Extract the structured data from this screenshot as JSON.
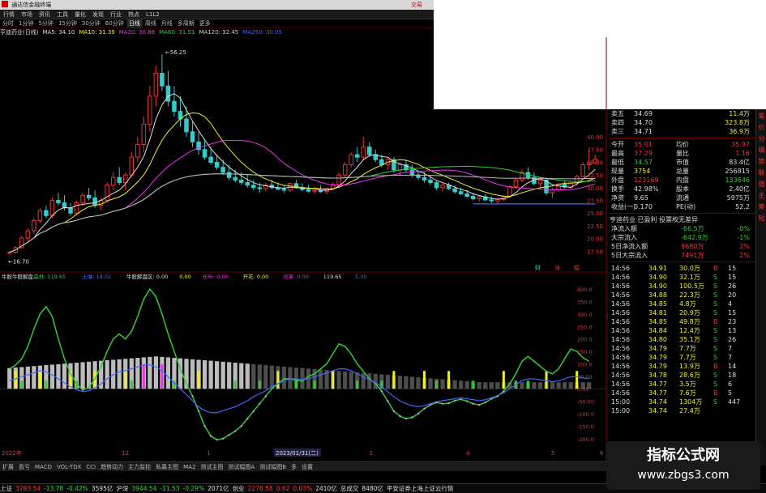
{
  "window": {
    "title": "通达信金融终端",
    "right_label": "交易"
  },
  "menu": [
    "行情",
    "市场",
    "资讯",
    "工具",
    "量化",
    "发现",
    "行业",
    "热点",
    "L1L2"
  ],
  "periods": [
    "分时",
    "1分钟",
    "5分钟",
    "15分钟",
    "30分钟",
    "60分钟",
    "日线",
    "周线",
    "月线",
    "多周期",
    "更多"
  ],
  "active_period": "日线",
  "ma_legend": [
    {
      "label": "亨迪药业(日线)",
      "color": "#dddddd"
    },
    {
      "label": "MA5: 34.10",
      "color": "#dddddd"
    },
    {
      "label": "MA10: 31.39",
      "color": "#eeee33"
    },
    {
      "label": "MA20: 30.88",
      "color": "#ee33ee"
    },
    {
      "label": "MA60: 31.51",
      "color": "#33cc33"
    },
    {
      "label": "MA120: 32.45",
      "color": "#cccccc"
    },
    {
      "label": "MA250: 30.05",
      "color": "#4466ff"
    }
  ],
  "chart": {
    "price_high_label": "56.25",
    "price_low_label": "16.70",
    "price_axis": [
      "40.00",
      "37.50",
      "35.00",
      "32.50",
      "30.00",
      "27.50",
      "25.00",
      "22.50",
      "20.00",
      "17.50"
    ],
    "markers": [
      "财",
      "涨",
      "幅"
    ],
    "indicator_name": "牛股牛股解盘",
    "indicator_legend": [
      {
        "label": "牛股牛股解盘",
        "color": "#dddddd"
      },
      {
        "label": "森林: 119.65",
        "color": "#33cc33"
      },
      {
        "label": "土壤: 19.02",
        "color": "#4466ff"
      },
      {
        "label": "牛股解盘区: 0.00",
        "color": "#dddddd"
      },
      {
        "label": "0.00",
        "color": "#eeee33"
      },
      {
        "label": "长叶: 0.00",
        "color": "#ee33ee"
      },
      {
        "label": "开花: 0.00",
        "color": "#eeee33"
      },
      {
        "label": "结果: 0.00",
        "color": "#cc33cc"
      },
      {
        "label": "119.65",
        "color": "#dddddd"
      },
      {
        "label": "5.00",
        "color": "#4466ff"
      }
    ],
    "indicator_axis": [
      "400.0",
      "350.0",
      "300.0",
      "250.0",
      "200.0",
      "150.0",
      "100.0",
      "50.00",
      "0.00",
      "-50.00",
      "-100.0",
      "-150.0",
      "-200.0"
    ],
    "crosshair_value": "287.38",
    "date_axis": [
      "2022年",
      "12",
      "1",
      "2023/01/31(二)",
      "3",
      "4",
      "5",
      "6"
    ],
    "candles": [
      [
        17.2,
        17.5,
        16.7,
        17.3
      ],
      [
        17.3,
        18.5,
        17.1,
        18.2
      ],
      [
        18.2,
        20.5,
        18,
        20.1
      ],
      [
        20.1,
        22,
        19.5,
        21.5
      ],
      [
        21.5,
        24,
        21,
        23.5
      ],
      [
        23.5,
        26,
        23,
        25.5
      ],
      [
        25.5,
        26.5,
        24,
        24.5
      ],
      [
        24.5,
        28,
        24,
        27.5
      ],
      [
        27.5,
        29,
        26.5,
        27
      ],
      [
        27,
        28.5,
        25.5,
        26
      ],
      [
        26,
        27,
        24.5,
        25
      ],
      [
        25,
        27.5,
        24.5,
        27
      ],
      [
        27,
        29,
        26.5,
        28.5
      ],
      [
        28.5,
        30,
        27.5,
        28
      ],
      [
        28,
        29.5,
        26,
        26.5
      ],
      [
        26.5,
        28,
        25.5,
        27.5
      ],
      [
        27.5,
        31,
        27,
        30.5
      ],
      [
        30.5,
        33,
        29.5,
        32
      ],
      [
        32,
        34,
        30.5,
        31
      ],
      [
        31,
        33,
        29.5,
        32.5
      ],
      [
        32.5,
        37,
        32,
        36
      ],
      [
        36,
        40,
        35,
        38.5
      ],
      [
        38.5,
        44,
        37,
        42.5
      ],
      [
        42.5,
        50,
        41,
        48
      ],
      [
        48,
        54,
        46,
        52.5
      ],
      [
        52.5,
        56.25,
        49,
        50
      ],
      [
        50,
        53,
        46,
        47
      ],
      [
        47,
        50,
        44,
        45
      ],
      [
        45,
        48,
        42,
        43.5
      ],
      [
        43.5,
        46,
        40,
        41
      ],
      [
        41,
        43,
        38,
        39
      ],
      [
        39,
        41,
        36.5,
        37.5
      ],
      [
        37.5,
        39.5,
        35.5,
        36
      ],
      [
        36,
        38,
        34.5,
        35
      ],
      [
        35,
        36.5,
        33.5,
        34
      ],
      [
        34,
        35.5,
        32.5,
        33
      ],
      [
        33,
        34.5,
        31.5,
        32
      ],
      [
        32,
        33.5,
        31,
        31.5
      ],
      [
        31.5,
        33,
        30.5,
        31
      ],
      [
        31,
        32.5,
        30,
        30.5
      ],
      [
        30.5,
        31.5,
        29.5,
        30
      ],
      [
        30,
        31,
        29,
        29.8
      ],
      [
        29.8,
        31,
        29.3,
        30.5
      ],
      [
        30.5,
        31.5,
        29.7,
        30
      ],
      [
        30,
        31,
        29.5,
        29.7
      ],
      [
        29.7,
        30.5,
        29,
        29.5
      ],
      [
        29.5,
        31,
        29.2,
        30.8
      ],
      [
        30.8,
        31.5,
        29.8,
        30
      ],
      [
        30,
        30.8,
        29.3,
        29.6
      ],
      [
        29.6,
        30.5,
        29,
        29.3
      ],
      [
        29.3,
        30.2,
        28.8,
        29.5
      ],
      [
        29.5,
        30.5,
        29,
        29.2
      ],
      [
        29.2,
        30,
        28.7,
        29.8
      ],
      [
        29.8,
        31,
        29.4,
        30.6
      ],
      [
        30.6,
        33,
        30,
        32.5
      ],
      [
        32.5,
        35,
        32,
        34.5
      ],
      [
        34.5,
        37,
        34,
        36.5
      ],
      [
        36.5,
        38,
        35,
        36
      ],
      [
        36,
        40,
        35.5,
        38
      ],
      [
        38,
        39,
        36,
        36.5
      ],
      [
        36.5,
        37.5,
        35,
        35.5
      ],
      [
        35.5,
        36.5,
        34,
        34.5
      ],
      [
        34.5,
        36,
        33.5,
        35.5
      ],
      [
        35.5,
        36,
        33,
        33.5
      ],
      [
        33.5,
        35,
        32.5,
        34.5
      ],
      [
        34.5,
        35.5,
        33,
        33.5
      ],
      [
        33.5,
        34.5,
        32,
        32.5
      ],
      [
        32.5,
        33.5,
        31.5,
        32
      ],
      [
        32,
        33,
        31,
        31.5
      ],
      [
        31.5,
        32.5,
        30.5,
        31
      ],
      [
        31,
        31.5,
        29.5,
        30
      ],
      [
        30,
        31,
        29.3,
        30.5
      ],
      [
        30.5,
        31,
        29.5,
        29.8
      ],
      [
        29.8,
        30.5,
        28.8,
        29.2
      ],
      [
        29.2,
        30,
        28.5,
        28.8
      ],
      [
        28.8,
        29.5,
        28,
        28.3
      ],
      [
        28.3,
        29,
        27.5,
        27.8
      ],
      [
        27.8,
        28.5,
        27.2,
        28.2
      ],
      [
        28.2,
        28.8,
        27.3,
        27.6
      ],
      [
        27.6,
        28.3,
        27,
        27.4
      ],
      [
        27.4,
        28,
        26.8,
        27.7
      ],
      [
        27.7,
        28.5,
        27.3,
        28.2
      ],
      [
        28.2,
        30.5,
        28,
        30.2
      ],
      [
        30.2,
        32,
        29.8,
        31.5
      ],
      [
        31.5,
        33.5,
        31,
        33
      ],
      [
        33,
        34,
        31.5,
        32
      ],
      [
        32,
        33,
        30.5,
        30.8
      ],
      [
        30.8,
        32,
        30,
        31.5
      ],
      [
        31.5,
        32,
        28.5,
        29
      ],
      [
        29,
        30,
        28,
        29.6
      ],
      [
        29.6,
        31,
        29.2,
        30.7
      ],
      [
        30.7,
        31.5,
        29.8,
        30.1
      ],
      [
        30.1,
        31.2,
        29.7,
        30.9
      ],
      [
        30.9,
        32.5,
        30.5,
        32.2
      ],
      [
        32.2,
        35,
        32,
        34.5
      ],
      [
        34.5,
        37.3,
        33.5,
        34.9
      ],
      [
        34.9,
        36.5,
        34.57,
        35.6
      ]
    ],
    "indicator": [
      [
        80,
        8
      ],
      [
        95,
        10
      ],
      [
        120,
        12
      ],
      [
        170,
        14
      ],
      [
        240,
        16
      ],
      [
        300,
        18
      ],
      [
        330,
        17
      ],
      [
        290,
        14
      ],
      [
        200,
        10
      ],
      [
        120,
        6
      ],
      [
        60,
        2
      ],
      [
        20,
        -1
      ],
      [
        -5,
        -3
      ],
      [
        5,
        -2
      ],
      [
        40,
        1
      ],
      [
        90,
        5
      ],
      [
        150,
        10
      ],
      [
        200,
        14
      ],
      [
        220,
        17
      ],
      [
        200,
        18
      ],
      [
        230,
        20
      ],
      [
        290,
        22
      ],
      [
        360,
        24
      ],
      [
        400,
        24
      ],
      [
        370,
        22
      ],
      [
        300,
        18
      ],
      [
        220,
        12
      ],
      [
        150,
        6
      ],
      [
        80,
        0
      ],
      [
        20,
        -6
      ],
      [
        -30,
        -12
      ],
      [
        -90,
        -18
      ],
      [
        -150,
        -22
      ],
      [
        -190,
        -24
      ],
      [
        -205,
        -24
      ],
      [
        -200,
        -22
      ],
      [
        -185,
        -20
      ],
      [
        -170,
        -18
      ],
      [
        -150,
        -15
      ],
      [
        -120,
        -12
      ],
      [
        -90,
        -8
      ],
      [
        -60,
        -5
      ],
      [
        -30,
        -2
      ],
      [
        0,
        2
      ],
      [
        20,
        5
      ],
      [
        40,
        8
      ],
      [
        40,
        10
      ],
      [
        35,
        10
      ],
      [
        30,
        9
      ],
      [
        50,
        10
      ],
      [
        60,
        12
      ],
      [
        80,
        14
      ],
      [
        100,
        16
      ],
      [
        140,
        18
      ],
      [
        180,
        20
      ],
      [
        170,
        20
      ],
      [
        140,
        18
      ],
      [
        100,
        15
      ],
      [
        70,
        12
      ],
      [
        40,
        9
      ],
      [
        20,
        6
      ],
      [
        -10,
        2
      ],
      [
        -50,
        -3
      ],
      [
        -90,
        -8
      ],
      [
        -110,
        -12
      ],
      [
        -120,
        -15
      ],
      [
        -115,
        -17
      ],
      [
        -100,
        -18
      ],
      [
        -80,
        -17
      ],
      [
        -65,
        -15
      ],
      [
        -55,
        -13
      ],
      [
        -60,
        -12
      ],
      [
        -58,
        -11
      ],
      [
        -48,
        -10
      ],
      [
        -42,
        -9
      ],
      [
        -50,
        -10
      ],
      [
        -60,
        -11
      ],
      [
        -65,
        -12
      ],
      [
        -55,
        -11
      ],
      [
        -40,
        -9
      ],
      [
        -30,
        -7
      ],
      [
        -10,
        -4
      ],
      [
        20,
        0
      ],
      [
        60,
        4
      ],
      [
        110,
        8
      ],
      [
        130,
        10
      ],
      [
        110,
        10
      ],
      [
        90,
        9
      ],
      [
        70,
        8
      ],
      [
        60,
        7
      ],
      [
        80,
        8
      ],
      [
        120,
        10
      ],
      [
        160,
        12
      ],
      [
        150,
        12
      ],
      [
        125,
        11
      ],
      [
        110,
        10
      ]
    ],
    "yellow_bars": [
      1,
      5,
      10,
      14,
      19,
      25,
      31,
      44,
      53,
      63,
      68,
      72,
      81,
      88,
      93
    ],
    "green_bars": [
      2,
      6,
      11,
      20,
      27,
      37,
      41,
      47,
      50,
      57,
      61,
      70,
      76,
      83,
      85
    ],
    "magenta_bars": [
      22,
      25
    ]
  },
  "quotes_top": [
    {
      "label": "卖五",
      "price": "34.69",
      "vol": "11.4万",
      "pc": "#dddddd"
    },
    {
      "label": "卖四",
      "price": "34.70",
      "vol": "323.8万",
      "pc": "#dddddd"
    },
    {
      "label": "卖三",
      "price": "34.71",
      "vol": "36.9万",
      "pc": "#dddddd"
    }
  ],
  "quote_stats": [
    {
      "l": "今开",
      "v": "35.01",
      "vc": "#ee3333",
      "l2": "均价",
      "v2": "35.97",
      "v2c": "#ee3333"
    },
    {
      "l": "最高",
      "v": "37.29",
      "vc": "#ee3333",
      "l2": "量比",
      "v2": "1.16",
      "v2c": "#ee3333"
    },
    {
      "l": "最低",
      "v": "34.57",
      "vc": "#33cc33",
      "l2": "市值",
      "v2": "83.4亿",
      "v2c": "#dddddd"
    },
    {
      "l": "现量",
      "v": "3754",
      "vc": "#eeee33",
      "l2": "总量",
      "v2": "256815",
      "v2c": "#dddddd"
    },
    {
      "l": "外盘",
      "v": "123169",
      "vc": "#ee3333",
      "l2": "内盘",
      "v2": "133646",
      "v2c": "#33cc33"
    },
    {
      "l": "换手",
      "v": "42.98%",
      "vc": "#dddddd",
      "l2": "股本",
      "v2": "2.40亿",
      "v2c": "#dddddd"
    },
    {
      "l": "净资",
      "v": "9.65",
      "vc": "#dddddd",
      "l2": "流通",
      "v2": "5975万",
      "v2c": "#dddddd"
    },
    {
      "l": "收益(一)",
      "v": "0.170",
      "vc": "#dddddd",
      "l2": "PE(动)",
      "v2": "52.2",
      "v2c": "#dddddd"
    }
  ],
  "profile_line": "亨迪药业 已盈利 投票权无差异",
  "flows": [
    {
      "l": "净流入额",
      "v": "-66.5万",
      "p": "-0%"
    },
    {
      "l": "大宗流入",
      "v": "-642.9万",
      "p": "-1%"
    },
    {
      "l": "5日净流入额",
      "v": "9680万",
      "p": "2%"
    },
    {
      "l": "5日大宗流入",
      "v": "7491万",
      "p": "2%"
    }
  ],
  "ticks": [
    {
      "t": "14:56",
      "p": "34.91",
      "v": "30.0万",
      "bs": "B",
      "n": "15"
    },
    {
      "t": "14:56",
      "p": "34.90",
      "v": "32.1万",
      "bs": "S",
      "n": "15"
    },
    {
      "t": "14:56",
      "p": "34.90",
      "v": "100.5万",
      "bs": "S",
      "n": "26"
    },
    {
      "t": "14:56",
      "p": "34.88",
      "v": "22.3万",
      "bs": "S",
      "n": "20"
    },
    {
      "t": "14:56",
      "p": "34.85",
      "v": "4.8万",
      "bs": "S",
      "n": "4"
    },
    {
      "t": "14:56",
      "p": "34.81",
      "v": "20.9万",
      "bs": "S",
      "n": "15"
    },
    {
      "t": "14:56",
      "p": "34.85",
      "v": "49.8万",
      "bs": "B",
      "n": "23"
    },
    {
      "t": "14:56",
      "p": "34.84",
      "v": "12.4万",
      "bs": "S",
      "n": "13"
    },
    {
      "t": "14:56",
      "p": "34.80",
      "v": "35.1万",
      "bs": "S",
      "n": "26"
    },
    {
      "t": "14:56",
      "p": "34.79",
      "v": "7.7万",
      "bs": "S",
      "n": "7"
    },
    {
      "t": "14:56",
      "p": "34.79",
      "v": "7.7万",
      "bs": "S",
      "n": "7"
    },
    {
      "t": "14:56",
      "p": "34.79",
      "v": "13.9万",
      "bs": "B",
      "n": "14"
    },
    {
      "t": "14:56",
      "p": "34.78",
      "v": "28.6万",
      "bs": "S",
      "n": "18"
    },
    {
      "t": "14:56",
      "p": "34.77",
      "v": "3.5万",
      "bs": "S",
      "n": "6"
    },
    {
      "t": "14:56",
      "p": "34.77",
      "v": "7.6万",
      "bs": "B",
      "n": "5"
    },
    {
      "t": "15:00",
      "p": "34.74",
      "v": "1304万",
      "bs": "S",
      "n": "447"
    },
    {
      "t": "15:00",
      "p": "34.74",
      "v": "27.4万",
      "bs": "",
      "n": ""
    }
  ],
  "side_tabs": [
    "笔",
    "价",
    "分",
    "细",
    "势",
    "联",
    "值",
    "主",
    "筹",
    "短"
  ],
  "bottom_tabs": [
    "扩展",
    "盈亏",
    "MACD",
    "VOL-TDX",
    "CCI",
    "趋势动力",
    "主力监控",
    "私募主图",
    "MA2",
    "测试主图",
    "测试幅图A",
    "测试幅图B",
    "多",
    "设置"
  ],
  "statusbar": [
    {
      "t": "上证",
      "c": "#dddddd"
    },
    {
      "t": "3283.54",
      "c": "#ee3333"
    },
    {
      "t": "-13.78",
      "c": "#33cc33"
    },
    {
      "t": "-0.42%",
      "c": "#33cc33"
    },
    {
      "t": "3595亿",
      "c": "#dddddd"
    },
    {
      "t": "沪深",
      "c": "#dddddd"
    },
    {
      "t": "3944.54",
      "c": "#33cc33"
    },
    {
      "t": "-11.53",
      "c": "#33cc33"
    },
    {
      "t": "-0.29%",
      "c": "#33cc33"
    },
    {
      "t": "2071亿",
      "c": "#dddddd"
    },
    {
      "t": "创业",
      "c": "#dddddd"
    },
    {
      "t": "2278.58",
      "c": "#ee3333"
    },
    {
      "t": "0.62",
      "c": "#ee3333"
    },
    {
      "t": "0.03%",
      "c": "#ee3333"
    },
    {
      "t": "2410亿",
      "c": "#dddddd"
    },
    {
      "t": "总成交",
      "c": "#dddddd"
    },
    {
      "t": "8480亿",
      "c": "#dddddd"
    },
    {
      "t": "平安证券上海上证云行情",
      "c": "#dddddd"
    }
  ],
  "watermark": {
    "line1": "指标公式网",
    "line2": "www.zbgs3.com"
  }
}
